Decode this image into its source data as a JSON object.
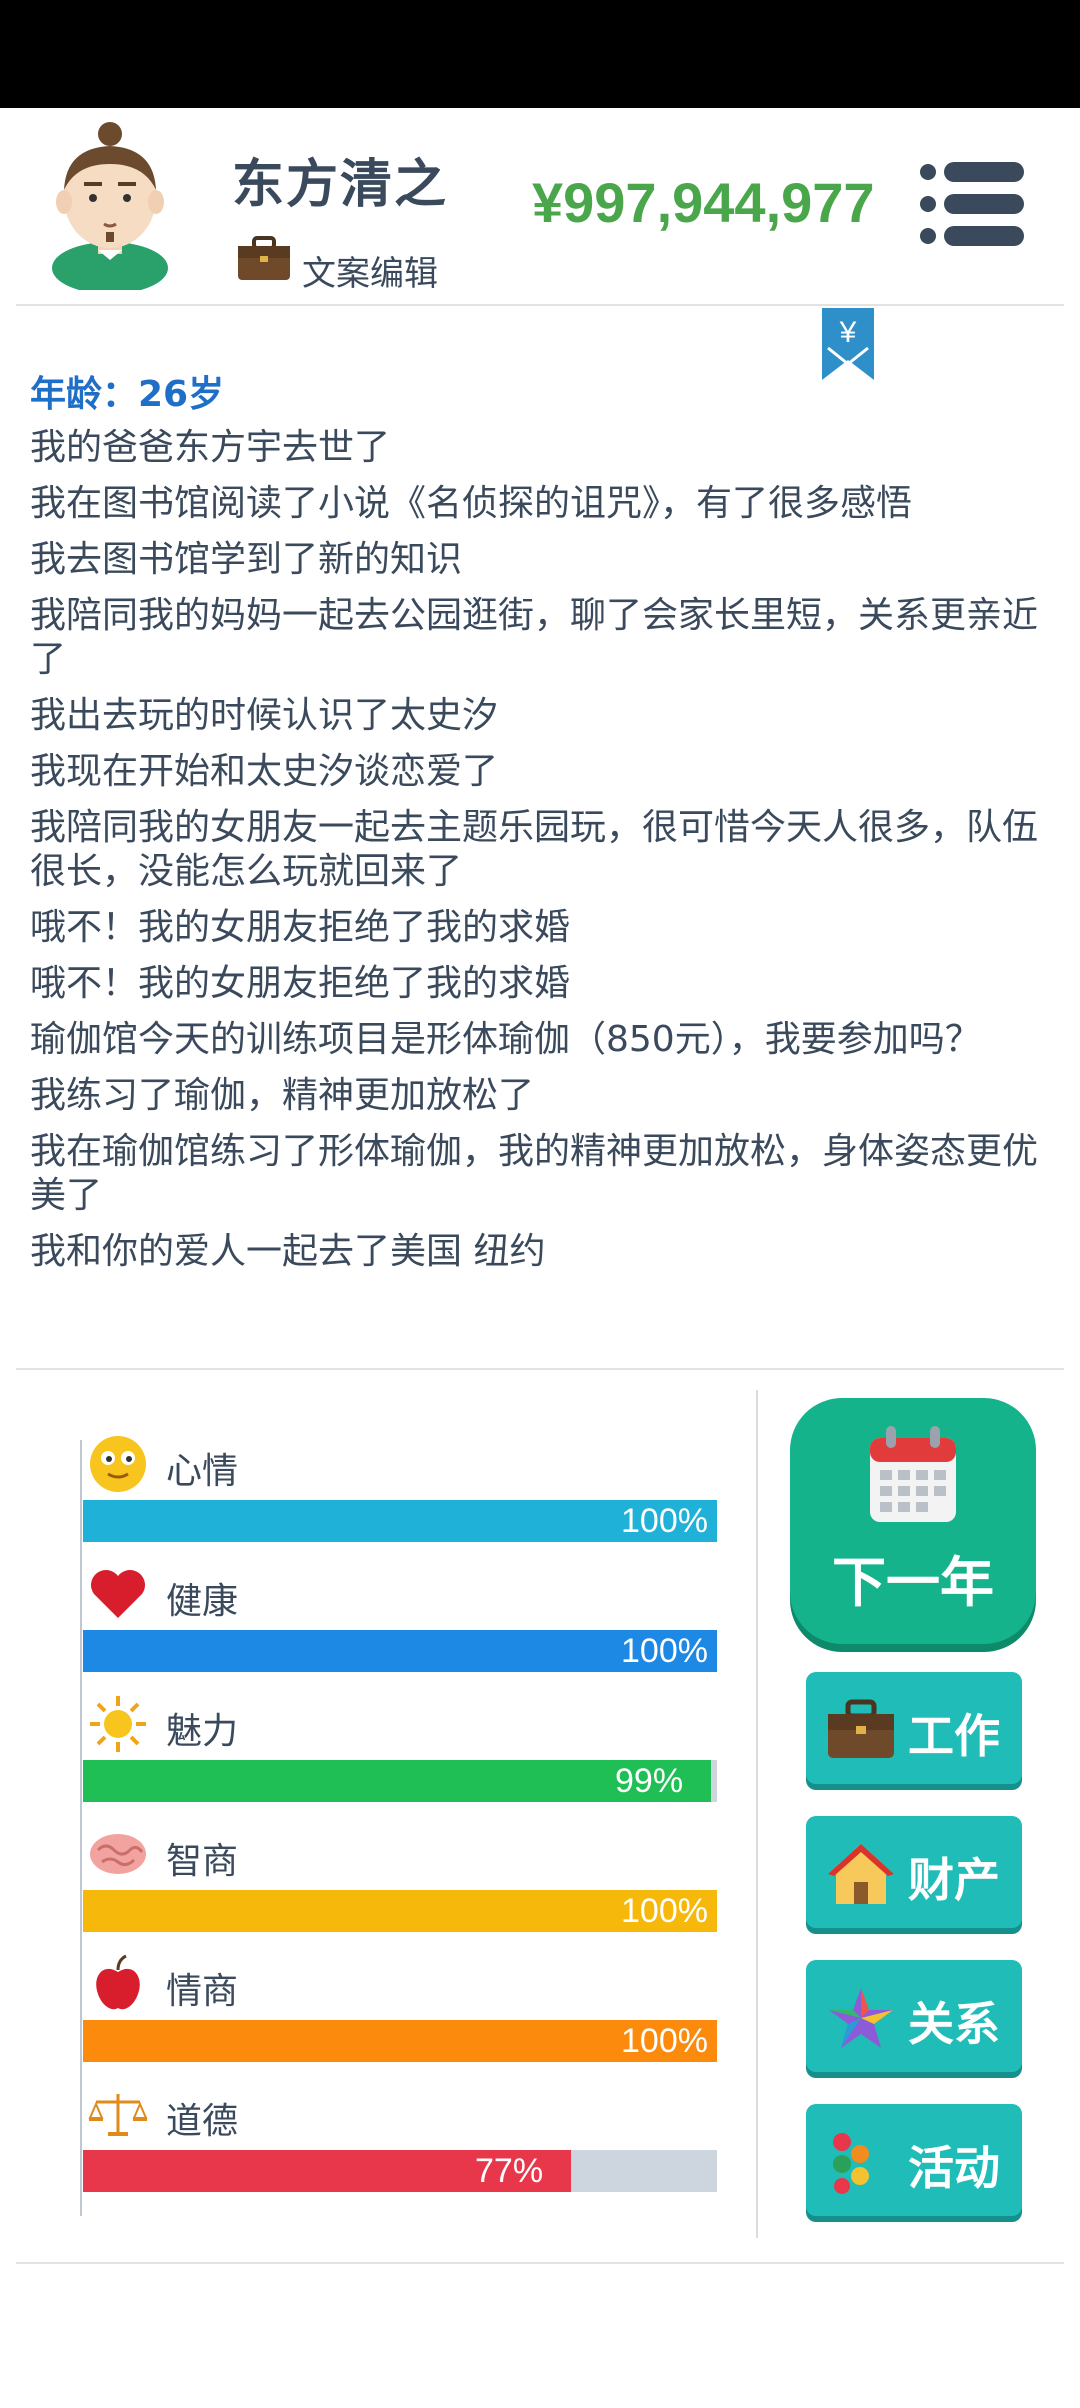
{
  "header": {
    "name": "东方清之",
    "job": "文案编辑",
    "money": "¥997,944,977"
  },
  "bookmark": {
    "symbol": "¥"
  },
  "log": {
    "age": "年龄：26岁",
    "entries": [
      "我的爸爸东方宇去世了",
      "我在图书馆阅读了小说《名侦探的诅咒》，有了很多感悟",
      "我去图书馆学到了新的知识",
      "我陪同我的妈妈一起去公园逛街，聊了会家长里短，关系更亲近了",
      "我出去玩的时候认识了太史汐",
      "我现在开始和太史汐谈恋爱了",
      "我陪同我的女朋友一起去主题乐园玩，很可惜今天人很多，队伍很长，没能怎么玩就回来了",
      "哦不！我的女朋友拒绝了我的求婚",
      "哦不！我的女朋友拒绝了我的求婚",
      "瑜伽馆今天的训练项目是形体瑜伽（850元），我要参加吗？",
      "我练习了瑜伽，精神更加放松了",
      "我在瑜伽馆练习了形体瑜伽，我的精神更加放松，身体姿态更优美了",
      "我和你的爱人一起去了美国 纽约"
    ]
  },
  "stats": [
    {
      "label": "心情",
      "icon": "smiley-icon",
      "percent_text": "100%",
      "value": 1.0,
      "color": "#1fb1d8"
    },
    {
      "label": "健康",
      "icon": "heart-icon",
      "percent_text": "100%",
      "value": 1.0,
      "color": "#1e88e5"
    },
    {
      "label": "魅力",
      "icon": "sun-icon",
      "percent_text": "99%",
      "value": 0.99,
      "color": "#20bf55"
    },
    {
      "label": "智商",
      "icon": "brain-icon",
      "percent_text": "100%",
      "value": 1.0,
      "color": "#f6b90b"
    },
    {
      "label": "情商",
      "icon": "apple-icon",
      "percent_text": "100%",
      "value": 1.0,
      "color": "#fb8a0d"
    },
    {
      "label": "道德",
      "icon": "scales-icon",
      "percent_text": "77%",
      "value": 0.77,
      "color": "#e8374b"
    }
  ],
  "buttons": {
    "next_year": "下一年",
    "work": "工作",
    "property": "财产",
    "relations": "关系",
    "activities": "活动"
  },
  "colors": {
    "money": "#4aa64a",
    "primary_button": "#14b38c",
    "action_button": "#1fbcb8",
    "age_text": "#1f6fc9"
  }
}
